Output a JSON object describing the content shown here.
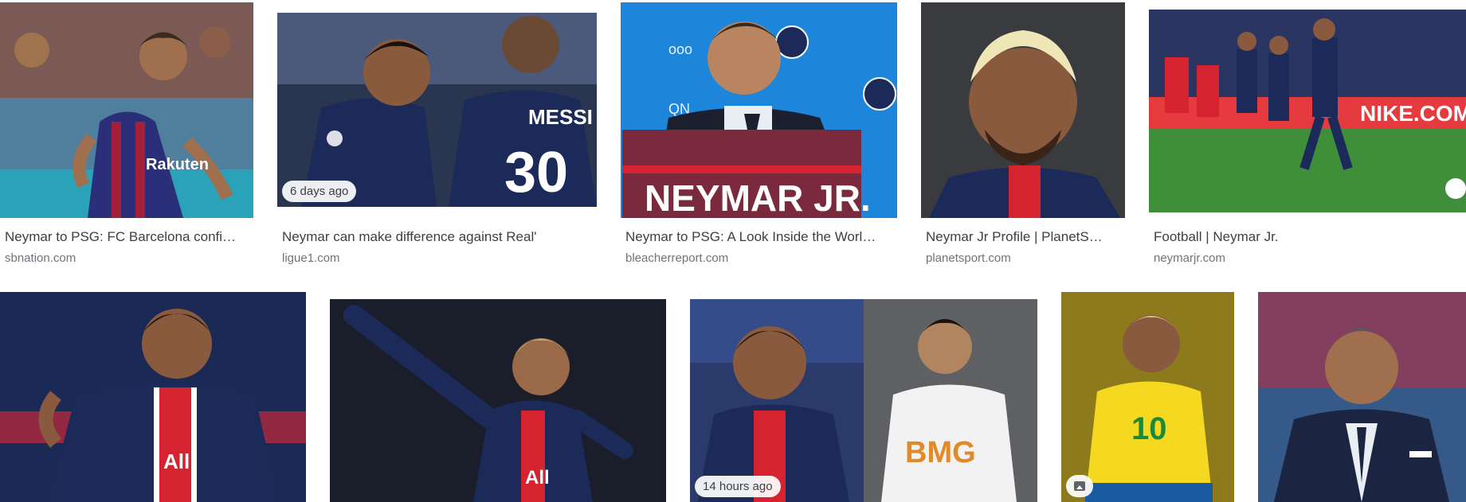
{
  "results_row1": [
    {
      "caption": "Neymar to PSG: FC Barcelona confi…",
      "source": "sbnation.com",
      "badge": ""
    },
    {
      "caption": "Neymar can make difference against Real'",
      "source": "ligue1.com",
      "badge": "6 days ago"
    },
    {
      "caption": "Neymar to PSG: A Look Inside the Worl…",
      "source": "bleacherreport.com",
      "badge": ""
    },
    {
      "caption": "Neymar Jr Profile | PlanetS…",
      "source": "planetsport.com",
      "badge": ""
    },
    {
      "caption": "Football | Neymar Jr.",
      "source": "neymarjr.com",
      "badge": ""
    }
  ],
  "results_row2": [
    {
      "badge": ""
    },
    {
      "badge": ""
    },
    {
      "badge": "14 hours ago"
    },
    {
      "badge": "image-icon"
    },
    {
      "badge": ""
    }
  ],
  "image_text": {
    "shirt_name": "NEYMAR JR.",
    "messi_back": "MESSI",
    "messi_number": "30",
    "rakuten": "Rakuten",
    "accor": "All",
    "brazil_number": "10",
    "santos_sponsor": "BMG",
    "nike_board": "NIKE.COM"
  },
  "colors": {
    "psg_navy": "#1c2a5a",
    "psg_red": "#d5232f",
    "barca_blue": "#2b2f7a",
    "brazil_yellow": "#f5d820",
    "pitch_green": "#3f8f3a"
  }
}
